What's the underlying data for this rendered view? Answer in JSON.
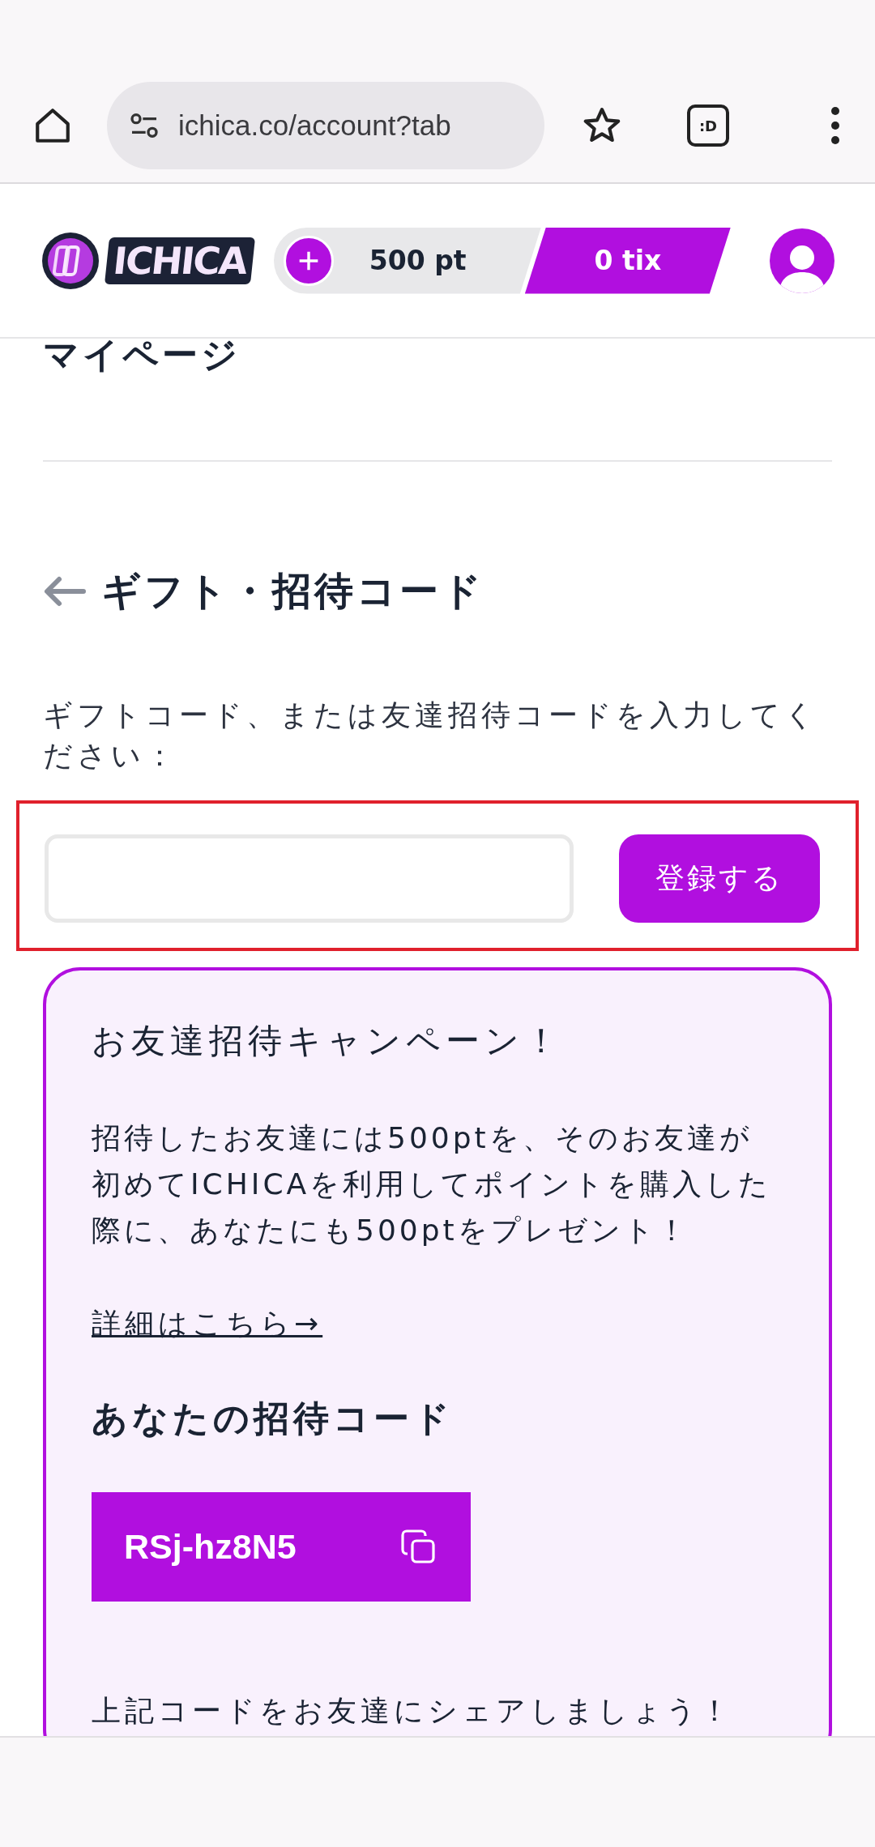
{
  "browser": {
    "url": "ichica.co/account?tab",
    "tab_count": ":D"
  },
  "header": {
    "logo": "ICHICA",
    "points": "500 pt",
    "tickets": "0 tix"
  },
  "page_title": "マイページ",
  "section": {
    "title": "ギフト・招待コード",
    "instructions": "ギフトコード、または友達招待コードを入力してください：",
    "register_button": "登録する"
  },
  "campaign": {
    "title": "お友達招待キャンペーン！",
    "body": "招待したお友達には500ptを、そのお友達が初めてICHICAを利用してポイントを購入した際に、あなたにも500ptをプレゼント！",
    "link": "詳細はこちら→",
    "code_heading": "あなたの招待コード",
    "code": "RSj-hz8N5",
    "share_text": "上記コードをお友達にシェアしましょう！"
  }
}
